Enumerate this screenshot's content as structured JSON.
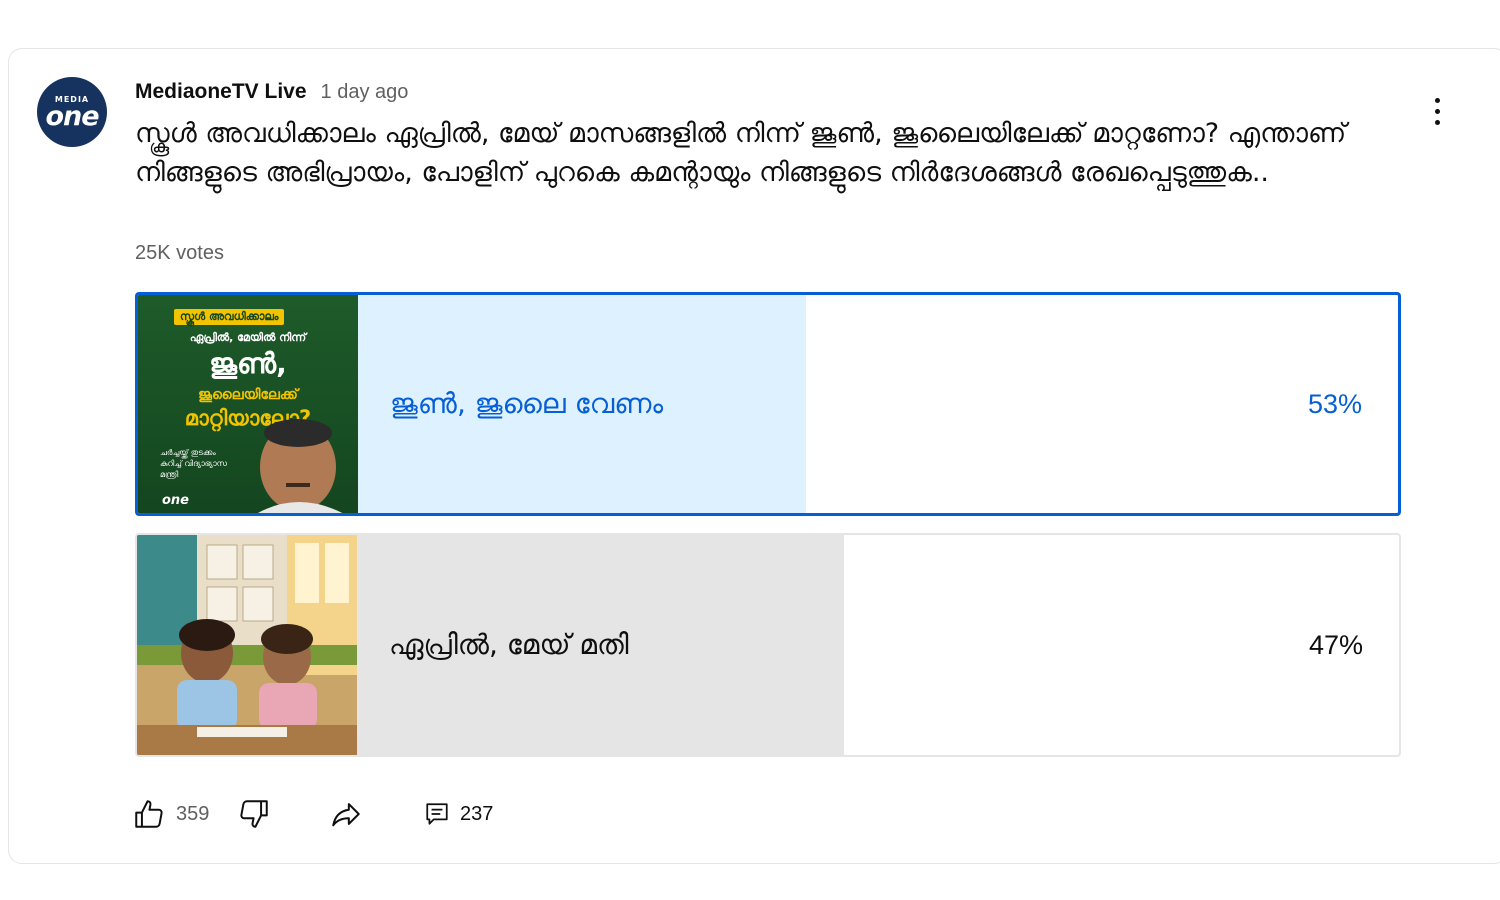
{
  "channel": {
    "name": "MediaoneTV Live",
    "time": "1 day ago",
    "avatar": {
      "small": "MEDIA",
      "big": "one"
    }
  },
  "post": {
    "question": "സ്കൂൾ അവധിക്കാലം ഏപ്രിൽ, മേയ് മാസങ്ങളിൽ നിന്ന് ജൂൺ, ജൂലൈയിലേക്ക് മാറ്റണോ? എന്താണ് നിങ്ങളുടെ അഭിപ്രായം, പോളിന് പുറകെ കമന്റായും നിങ്ങളുടെ നിർദേശങ്ങൾ രേഖപ്പെടുത്തുക..",
    "votes": "25K votes"
  },
  "poll": {
    "options": [
      {
        "label": "ജൂൺ, ജൂലൈ വേണം",
        "percent_text": "53%",
        "percent": 53,
        "selected": true,
        "thumb": {
          "tag": "സ്കൂൾ അവധിക്കാലം",
          "line1": "ഏപ്രിൽ, മേയിൽ നിന്ന്",
          "line2": "ജൂൺ,",
          "line3": "ജൂലൈയിലേക്ക്",
          "line4": "മാറ്റിയാലോ?",
          "line5": "ചർച്ചയ്ക്ക് തുടക്കം കുറിച്ച് വിദ്യാഭ്യാസ മന്ത്രി",
          "brand": "one"
        }
      },
      {
        "label": "ഏപ്രിൽ, മേയ് മതി",
        "percent_text": "47%",
        "percent": 47,
        "selected": false
      }
    ]
  },
  "actions": {
    "likes": "359",
    "comments": "237"
  },
  "colors": {
    "selected_border": "#065fd4",
    "selected_fill": "#def1ff",
    "unselected_fill": "#e5e5e5",
    "avatar_bg": "#16325f"
  }
}
